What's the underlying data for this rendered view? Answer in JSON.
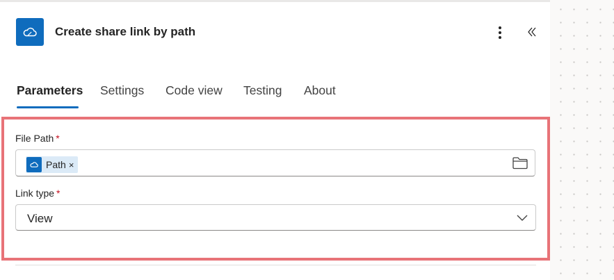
{
  "header": {
    "title": "Create share link by path",
    "app_icon": "onedrive-cloud-icon",
    "more_icon": "more-vertical-icon",
    "collapse_icon": "double-chevron-left-icon"
  },
  "tabs": [
    {
      "label": "Parameters",
      "active": true
    },
    {
      "label": "Settings",
      "active": false
    },
    {
      "label": "Code view",
      "active": false
    },
    {
      "label": "Testing",
      "active": false
    },
    {
      "label": "About",
      "active": false
    }
  ],
  "form": {
    "file_path": {
      "label": "File Path",
      "required_mark": "*",
      "token_label": "Path",
      "token_remove": "×",
      "browse_icon": "folder-icon"
    },
    "link_type": {
      "label": "Link type",
      "required_mark": "*",
      "value": "View",
      "dropdown_icon": "chevron-down-icon"
    }
  },
  "colors": {
    "accent": "#0f6cbd",
    "highlight_border": "#e87378",
    "required": "#c50f1f",
    "token_bg": "#dbeaf7"
  }
}
